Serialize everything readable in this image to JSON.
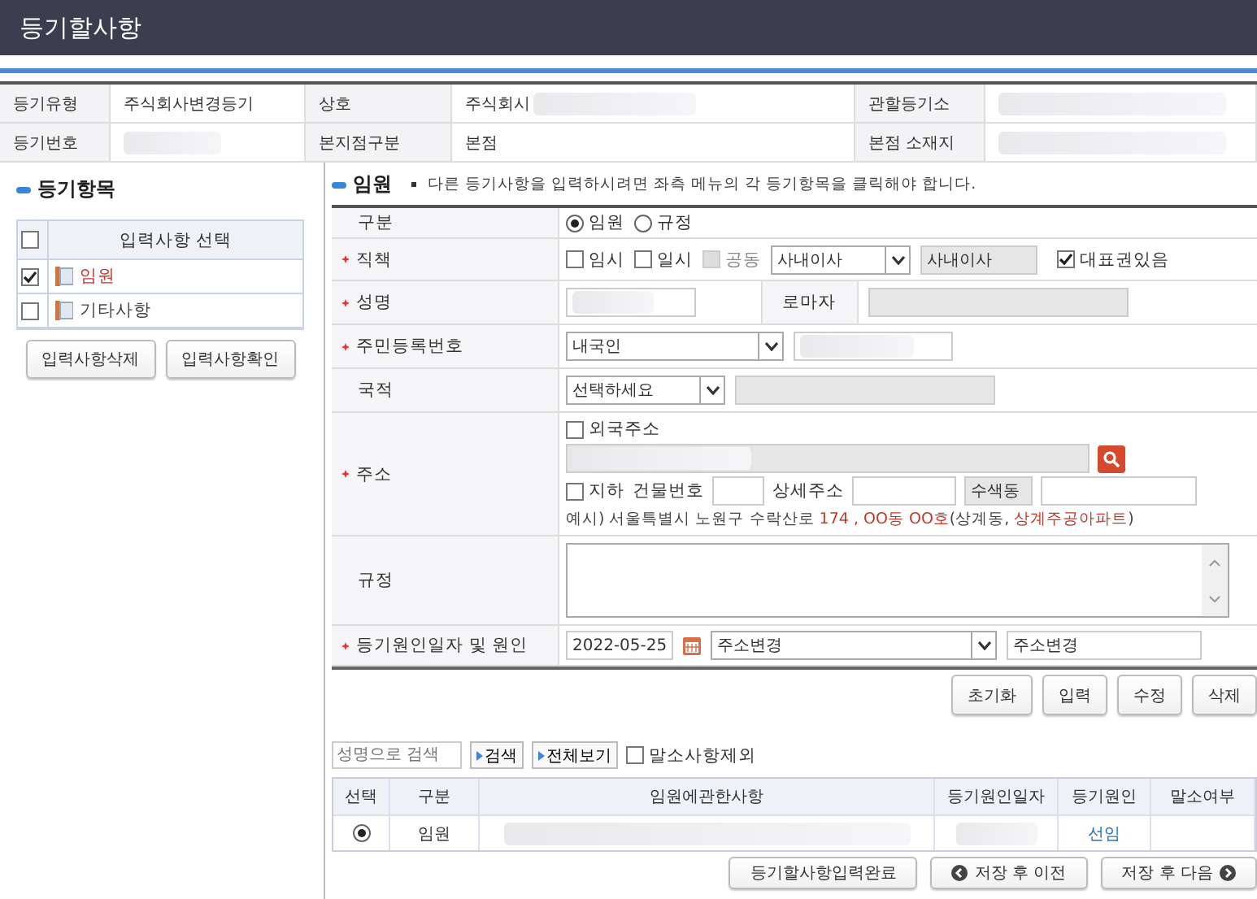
{
  "title": "등기할사항",
  "info": [
    [
      {
        "label": "등기유형",
        "value": "주식회사변경등기",
        "blur": false
      },
      {
        "label": "상호",
        "value": "주식회시",
        "blur": true
      },
      {
        "label": "관할등기소",
        "blur": true
      }
    ],
    [
      {
        "label": "등기번호",
        "blur": true
      },
      {
        "label": "본지점구분",
        "value": "본점",
        "blur": false
      },
      {
        "label": "본점 소재지",
        "blur": true
      }
    ]
  ],
  "sidebar": {
    "heading": "등기항목",
    "column": "입력사항 선택",
    "all_checked": false,
    "items": [
      {
        "label": "임원",
        "checked": true,
        "selected": true
      },
      {
        "label": "기타사항",
        "checked": false,
        "selected": false
      }
    ],
    "buttons": [
      "입력사항삭제",
      "입력사항확인"
    ]
  },
  "form": {
    "heading": "임원",
    "hint": "다른 등기사항을 입력하시려면 좌측 메뉴의 각 등기항목을 클릭해야 합니다.",
    "division": {
      "label": "구분",
      "required": false,
      "options": [
        {
          "label": "임원",
          "selected": true
        },
        {
          "label": "규정",
          "selected": false
        }
      ]
    },
    "position": {
      "label": "직책",
      "required": true,
      "checks": [
        {
          "label": "임시",
          "checked": false,
          "disabled": false
        },
        {
          "label": "일시",
          "checked": false,
          "disabled": false
        },
        {
          "label": "공동",
          "checked": false,
          "disabled": true
        }
      ],
      "select": "사내이사",
      "display": "사내이사",
      "rep": {
        "label": "대표권있음",
        "checked": true
      }
    },
    "name": {
      "label": "성명",
      "required": true,
      "roman_label": "로마자"
    },
    "resident": {
      "label": "주민등록번호",
      "required": true,
      "select": "내국인"
    },
    "nationality": {
      "label": "국적",
      "required": false,
      "select": "선택하세요"
    },
    "address": {
      "label": "주소",
      "required": true,
      "foreign": {
        "label": "외국주소",
        "checked": false
      },
      "underground": {
        "label": "지하",
        "checked": false
      },
      "building_label": "건물번호",
      "detail_label": "상세주소",
      "dong": "수색동",
      "example": [
        {
          "text": "예시) 서울특별시 노원구 수락산로 ",
          "accent": false
        },
        {
          "text": "174 , OO동 OO호",
          "accent": true
        },
        {
          "text": "(상계동, ",
          "accent": false
        },
        {
          "text": "상계주공아파트",
          "accent": true
        },
        {
          "text": ")",
          "accent": false
        }
      ]
    },
    "rule": {
      "label": "규정",
      "required": false
    },
    "cause": {
      "label": "등기원인일자 및 원인",
      "required": true,
      "date": "2022-05-25",
      "select": "주소변경",
      "text": "주소변경"
    },
    "actions": [
      "초기화",
      "입력",
      "수정",
      "삭제"
    ]
  },
  "search": {
    "placeholder": "성명으로 검색",
    "buttons": [
      "검색",
      "전체보기"
    ],
    "exclude": {
      "label": "말소사항제외",
      "checked": false
    }
  },
  "table": {
    "columns": [
      "선택",
      "구분",
      "임원에관한사항",
      "등기원인일자",
      "등기원인",
      "말소여부"
    ],
    "rows": [
      {
        "selected": true,
        "type": "임원",
        "cause": "선임"
      }
    ]
  },
  "footer": [
    {
      "label": "등기할사항입력완료",
      "kind": "plain"
    },
    {
      "label": "저장 후 이전",
      "kind": "prev"
    },
    {
      "label": "저장 후 다음",
      "kind": "next"
    }
  ]
}
